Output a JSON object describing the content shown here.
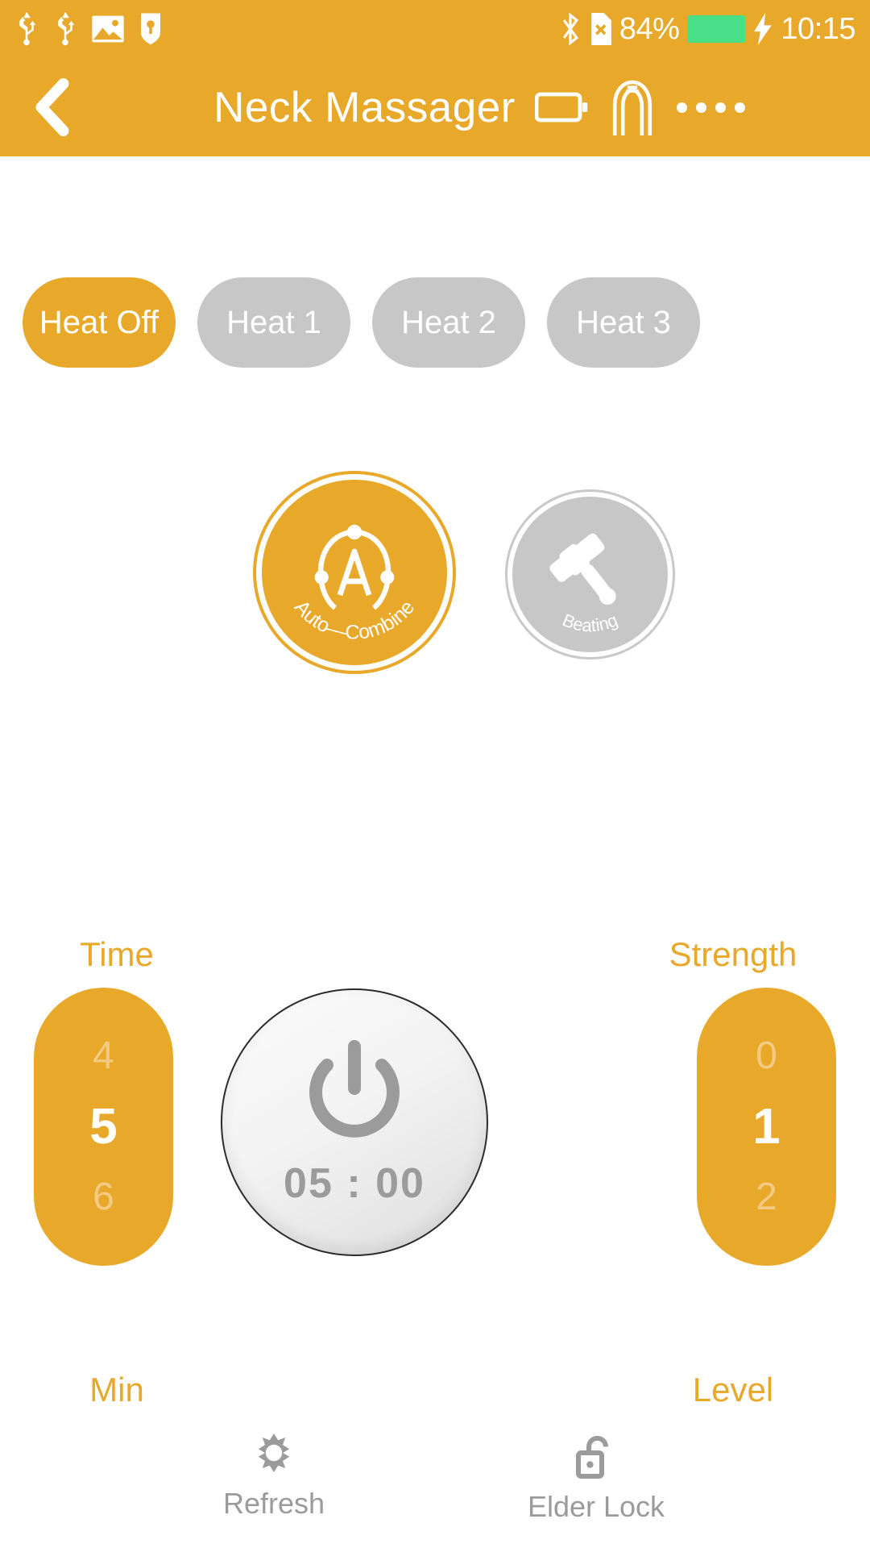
{
  "status_bar": {
    "left_icons": [
      "usb-icon",
      "usb-icon",
      "image-icon",
      "shield-key-icon"
    ],
    "bluetooth_icon": "bluetooth-icon",
    "sim_icon": "sim-card-off-icon",
    "battery_percent": "84%",
    "battery_level_color": "#4AE08A",
    "charging_icon": "charging-bolt-icon",
    "time": "10:15"
  },
  "app_bar": {
    "back_icon": "back-chevron-icon",
    "title": "Neck Massager",
    "battery_icon": "device-battery-icon",
    "device_icon": "neck-massager-device-icon",
    "menu_icon": "more-dots-icon"
  },
  "heat": {
    "options": [
      {
        "label": "Heat Off",
        "active": true
      },
      {
        "label": "Heat 1",
        "active": false
      },
      {
        "label": "Heat 2",
        "active": false
      },
      {
        "label": "Heat 3",
        "active": false
      }
    ]
  },
  "modes": [
    {
      "label": "Auto—Combine",
      "icon": "auto-combine-icon",
      "active": true
    },
    {
      "label": "Beating",
      "icon": "hammer-icon",
      "active": false
    }
  ],
  "time_control": {
    "title": "Time",
    "unit": "Min",
    "prev": "4",
    "current": "5",
    "next": "6"
  },
  "strength_control": {
    "title": "Strength",
    "unit": "Level",
    "prev": "0",
    "current": "1",
    "next": "2"
  },
  "power": {
    "icon": "power-icon",
    "timer": "05 : 00"
  },
  "bottom_bar": [
    {
      "label": "Refresh",
      "icon": "refresh-gear-icon"
    },
    {
      "label": "Elder Lock",
      "icon": "open-padlock-icon"
    }
  ],
  "colors": {
    "accent": "#E8A92B",
    "inactive": "#C7C7C7",
    "muted_text": "#9B9B9B"
  }
}
